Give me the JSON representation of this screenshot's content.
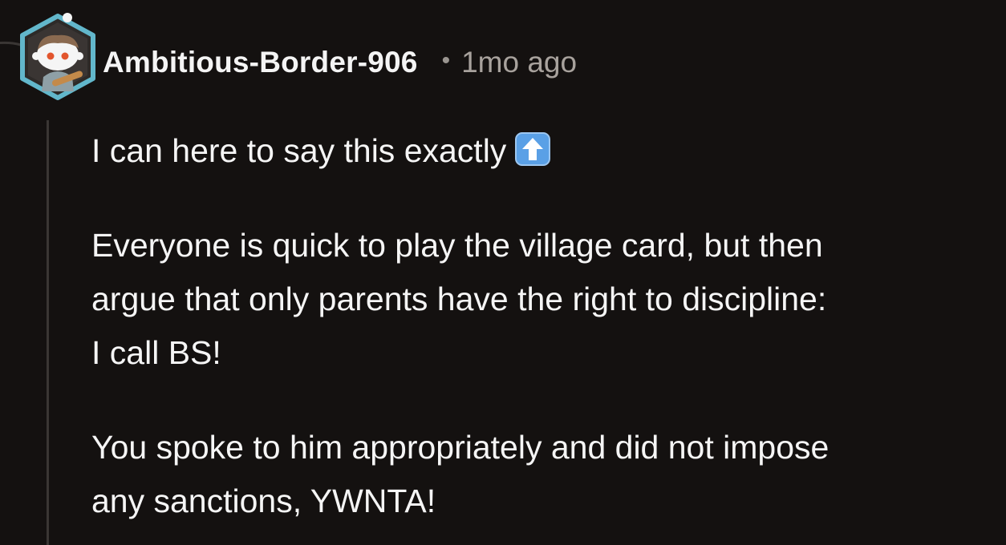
{
  "comment": {
    "author": "Ambitious-Border-906",
    "separator": "•",
    "time": "1mo ago",
    "avatar_icon": "snoo-avatar-icon",
    "paragraphs": [
      {
        "text": "I can here to say this exactly",
        "emoji": "up-arrow-emoji"
      },
      {
        "line1": "Everyone is quick to play the village card, but then",
        "line2": "argue that only parents have the right to discipline:",
        "line3": "I call BS!"
      },
      {
        "line1": "You spoke to him appropriately and did not impose",
        "line2": "any sanctions, YWNTA!"
      }
    ]
  },
  "colors": {
    "background": "#141110",
    "text": "#f5f5f5",
    "muted": "#a8a29d",
    "avatar_ring": "#5fb6c9",
    "emoji_blue": "#5aa0e6"
  }
}
